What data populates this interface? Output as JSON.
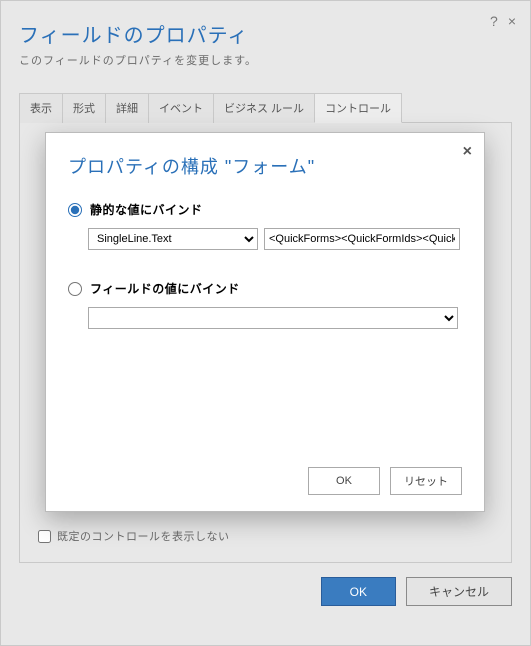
{
  "panel": {
    "title": "フィールドのプロパティ",
    "subtitle": "このフィールドのプロパティを変更します。",
    "help_icon": "?",
    "close_icon": "×"
  },
  "tabs": [
    {
      "label": "表示"
    },
    {
      "label": "形式"
    },
    {
      "label": "詳細"
    },
    {
      "label": "イベント"
    },
    {
      "label": "ビジネス ルール"
    },
    {
      "label": "コントロール"
    }
  ],
  "active_tab_index": 5,
  "checkbox": {
    "label": "既定のコントロールを表示しない",
    "checked": false
  },
  "bottom_buttons": {
    "ok": "OK",
    "cancel": "キャンセル"
  },
  "modal": {
    "title": "プロパティの構成 \"フォーム\"",
    "close_icon": "×",
    "option_static": {
      "label": "静的な値にバインド",
      "checked": true,
      "type_options": [
        "SingleLine.Text"
      ],
      "type_value": "SingleLine.Text",
      "static_value": "<QuickForms><QuickFormIds><Quick"
    },
    "option_field": {
      "label": "フィールドの値にバインド",
      "checked": false,
      "field_value": ""
    },
    "buttons": {
      "ok": "OK",
      "reset": "リセット"
    }
  }
}
